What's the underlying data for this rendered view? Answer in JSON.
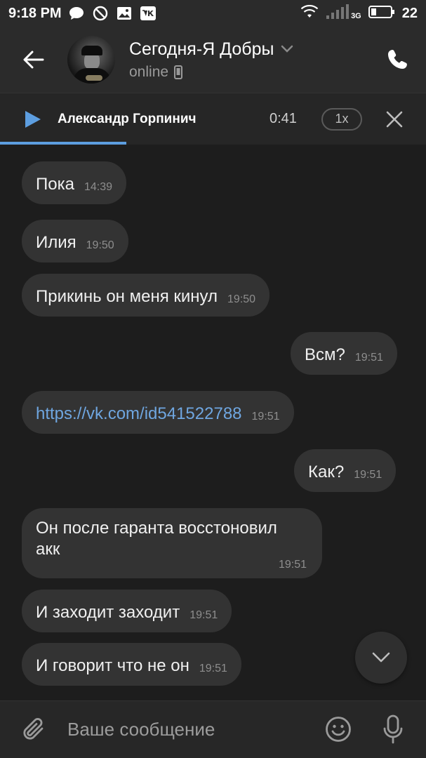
{
  "status_bar": {
    "time": "9:18 PM",
    "battery": "22",
    "network": "3G",
    "icons": [
      "chat-bubble-icon",
      "do-not-disturb-icon",
      "gallery-icon",
      "vk-icon",
      "wifi-icon",
      "signal-icon",
      "battery-icon"
    ]
  },
  "header": {
    "title": "Сегодня-Я Добры",
    "status": "online",
    "icons": [
      "back-arrow-icon",
      "chevron-down-icon",
      "mobile-device-icon",
      "phone-icon"
    ]
  },
  "player": {
    "track_name": "Александр Горпинич",
    "time": "0:41",
    "speed": "1x",
    "progress": 0.296,
    "icons": [
      "play-icon",
      "close-icon"
    ]
  },
  "messages": [
    {
      "text": "Пока",
      "time": "14:39",
      "side": "in"
    },
    {
      "text": "Илия",
      "time": "19:50",
      "side": "in"
    },
    {
      "text": "Прикинь он меня кинул",
      "time": "19:50",
      "side": "in"
    },
    {
      "text": "Всм?",
      "time": "19:51",
      "side": "out"
    },
    {
      "text": "https://vk.com/id541522788",
      "time": "19:51",
      "side": "in",
      "link": true
    },
    {
      "text": "Как?",
      "time": "19:51",
      "side": "out"
    },
    {
      "text_line1": "Он после гаранта восстоновил",
      "text_line2": "акк",
      "time": "19:51",
      "side": "in"
    },
    {
      "text": "И заходит заходит",
      "time": "19:51",
      "side": "in"
    },
    {
      "text": "И говорит что не он",
      "time": "19:51",
      "side": "in"
    }
  ],
  "composer": {
    "placeholder": "Ваше сообщение",
    "icons": [
      "paperclip-icon",
      "emoji-icon",
      "microphone-icon",
      "chevron-down-icon"
    ]
  },
  "colors": {
    "background": "#1d1d1d",
    "bar": "#2b2b2b",
    "bubble": "#333333",
    "accent": "#5d9ee0",
    "link": "#6fa6e0"
  }
}
